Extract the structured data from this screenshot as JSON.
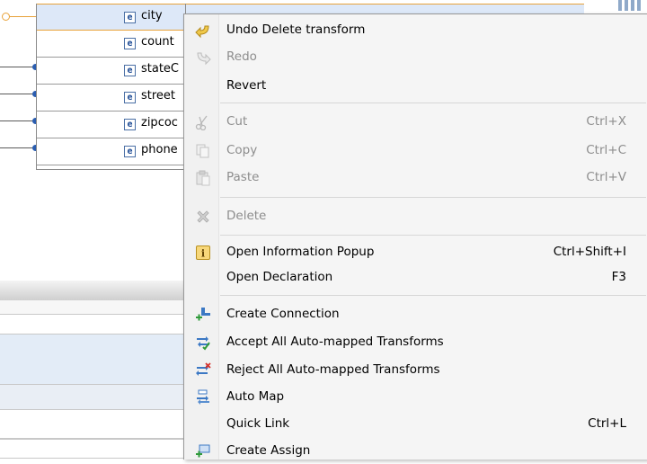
{
  "editor": {
    "elements": [
      {
        "icon": "e",
        "label": "city",
        "selected": true
      },
      {
        "icon": "e",
        "label": "count",
        "selected": false
      },
      {
        "icon": "e",
        "label": "stateC",
        "selected": false
      },
      {
        "icon": "e",
        "label": "street",
        "selected": false
      },
      {
        "icon": "e",
        "label": "zipcoc",
        "selected": false
      },
      {
        "icon": "e",
        "label": "phone",
        "selected": false
      }
    ]
  },
  "context_menu": {
    "items": [
      {
        "label": "Undo Delete transform",
        "shortcut": "",
        "icon": "undo-icon",
        "enabled": true
      },
      {
        "label": "Redo",
        "shortcut": "",
        "icon": "redo-icon",
        "enabled": false
      },
      {
        "label": "Revert",
        "shortcut": "",
        "icon": "",
        "enabled": true
      },
      {
        "label": "Cut",
        "shortcut": "Ctrl+X",
        "icon": "cut-icon",
        "enabled": false
      },
      {
        "label": "Copy",
        "shortcut": "Ctrl+C",
        "icon": "copy-icon",
        "enabled": false
      },
      {
        "label": "Paste",
        "shortcut": "Ctrl+V",
        "icon": "paste-icon",
        "enabled": false
      },
      {
        "label": "Delete",
        "shortcut": "",
        "icon": "delete-icon",
        "enabled": false
      },
      {
        "label": "Open Information Popup",
        "shortcut": "Ctrl+Shift+I",
        "icon": "info-icon",
        "enabled": true
      },
      {
        "label": "Open Declaration",
        "shortcut": "F3",
        "icon": "",
        "enabled": true
      },
      {
        "label": "Create Connection",
        "shortcut": "",
        "icon": "create-connection-icon",
        "enabled": true
      },
      {
        "label": "Accept All Auto-mapped Transforms",
        "shortcut": "",
        "icon": "accept-auto-mapped-icon",
        "enabled": true
      },
      {
        "label": "Reject All Auto-mapped Transforms",
        "shortcut": "",
        "icon": "reject-auto-mapped-icon",
        "enabled": true
      },
      {
        "label": "Auto Map",
        "shortcut": "",
        "icon": "auto-map-icon",
        "enabled": true
      },
      {
        "label": "Quick Link",
        "shortcut": "Ctrl+L",
        "icon": "",
        "enabled": true
      },
      {
        "label": "Create Assign",
        "shortcut": "",
        "icon": "create-assign-icon",
        "enabled": true
      }
    ]
  },
  "colors": {
    "selection": "#dde8f8",
    "selection_border": "#e8a23a",
    "connector": "#2a5db0",
    "menu_background": "#f5f5f5",
    "disabled_text": "#8d8d8d"
  }
}
